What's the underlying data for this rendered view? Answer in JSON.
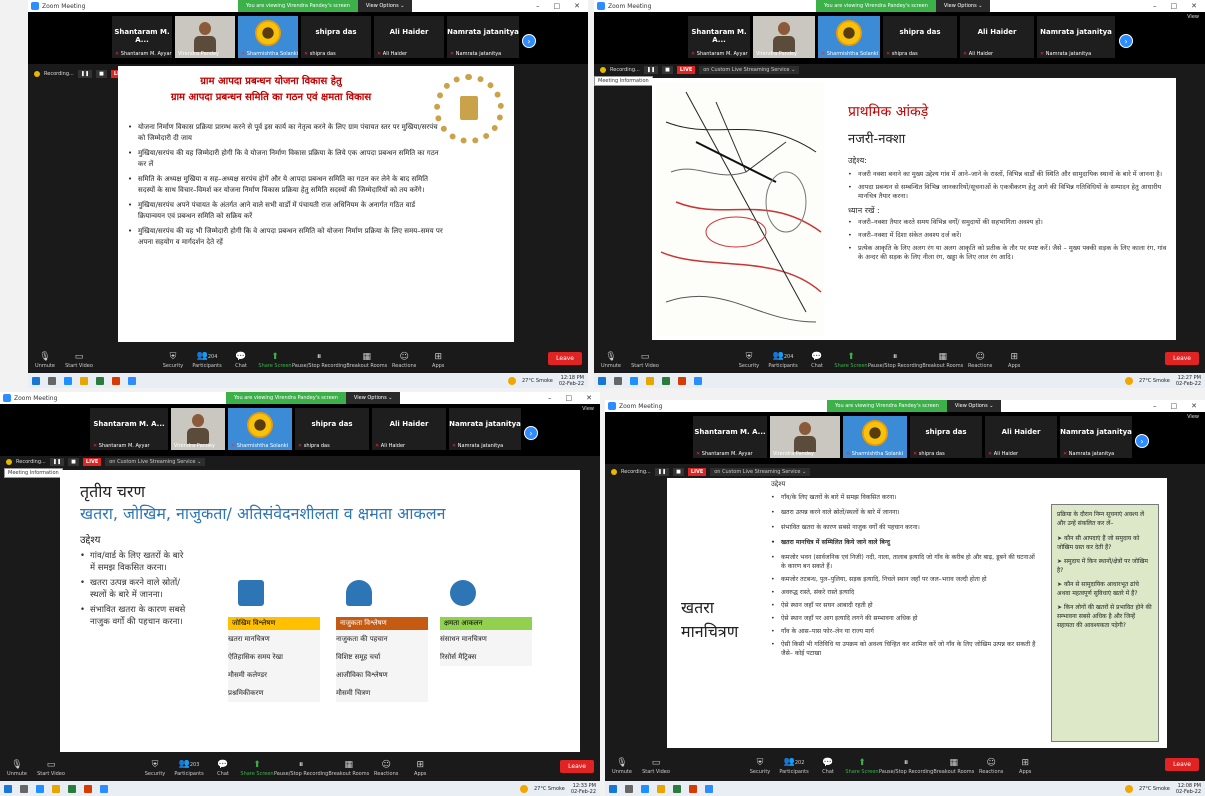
{
  "app": {
    "window_title": "Zoom Meeting",
    "banner": "You are viewing Virendra Pandey's screen",
    "view_options": "View Options ⌄",
    "view_label": "View",
    "meeting_info": "Meeting Information"
  },
  "participants": {
    "p1_name": "Shantaram M. A...",
    "p1_label": "Shantaram M. Ayyar",
    "p2_label": "Virendra Pandey",
    "p3_label": "Sharmishtha Solanki",
    "p4_name": "shipra das",
    "p4_label": "shipra das",
    "p5_name": "Ali Haider",
    "p5_label": "Ali Haider",
    "p6_name": "Namrata jatanitya",
    "p6_label": "Namrata jatanitya"
  },
  "recbar": {
    "recording": "Recording...",
    "live": "LIVE",
    "service": "on Custom Live Streaming Service ⌄"
  },
  "toolbar": {
    "unmute": "Unmute",
    "start_video": "Start Video",
    "security": "Security",
    "participants": "Participants",
    "chat": "Chat",
    "share": "Share Screen",
    "pause": "Pause/Stop Recording",
    "breakout": "Breakout Rooms",
    "reactions": "Reactions",
    "apps": "Apps",
    "leave": "Leave",
    "count_a": "204",
    "count_b": "204",
    "count_c": "203",
    "count_d": "202"
  },
  "taskbar": {
    "weather": "27°C Smoke",
    "time_a": "12:18 PM",
    "time_b": "12:27 PM",
    "time_c": "12:33 PM",
    "time_d": "12:08 PM",
    "date": "02-Feb-22"
  },
  "slide1": {
    "title1": "ग्राम आपदा प्रबन्धन योजना विकास हेतु",
    "title2": "ग्राम आपदा प्रबन्धन समिति का  गठन एवं क्षमता विकास",
    "bullets": [
      "योजना निर्माण विकास प्रक्रिया प्रारम्भ करने से पूर्व इस कार्य का नेतृत्व करने के लिए ग्राम पंचायत स्तर पर मुखिया/सरपंच को जिम्मेदारी दी जाय",
      "मुखिया/सरपंच की यह  जिम्मेदारी होगी कि वे योजना निर्माण विकास प्रक्रिया के लिये एक आपदा प्रबन्धन समिति का गठन कर लें",
      "समिति के अध्यक्ष मुखिया व सह–अध्यक्ष सरपंच होगें और ये आपदा प्रबन्धन समिति का गठन कर लेने के बाद समिति सदस्यों के साथ विचार–विमर्श कर योजना निर्माण विकास प्रक्रिया हेतु समिति सदस्यों की जिम्मेदारियों को तय करेंगे।",
      "मुखिया/सरपंच अपने पंचायत के अंतर्गत आने वाले सभी वार्डों में पंचायती राज अधिनियम के अनार्गत गठित वार्ड क्रियान्वयन एवं प्रबन्धन समिति को सक्रिय करें",
      "मुखिया/सरपंच की यह भी जिम्मेदारी होगी कि वे आपदा प्रबन्धन समिति को योजना निर्माण प्रक्रिया के लिए समय–समय पर अपना सहयोग व मार्गदर्शन देते रहें"
    ]
  },
  "slide2": {
    "title": "प्राथमिक आंकड़े",
    "subtitle": "नजरी-नक्शा",
    "purpose": "उद्देश्य:",
    "bullets": [
      "नजरी नक्शा बनाने का मुख्य उद्देश्य गांव में आने–जाने के रास्तों, विभिन्न वार्डों की स्थिति और सामुदायिक स्थानों के बारे में जानना है।",
      "आपदा प्रबन्धन से सम्बन्धित विभिन्न जानकारियों/सूचनाओं के एकत्रीकरण हेतु आगे की विभिन्न गतिविधियों के सम्पादन हेतु आधारीय मानचित्र तैयार करना।"
    ],
    "note": "ध्यान रखें :",
    "notes": [
      "नजरी–नक्शा तैयार करते समय विभिन्न वर्गों/ समुदायों की सहभागिता अवश्य हो।",
      "नजरी–नक्शा में दिशा संकेत अवश्य दर्ज करें।",
      "प्रत्येक आकृति के लिए अलग रंग या अलग आकृति को प्रतीक के तौर पर स्पष्ट करें। जैसे – मुख्य पक्की सड़क के लिए काला रंग, गांव के अन्दर की सड़क के लिए नीला रंग, खड्डा के लिए लाल रंग आदि।"
    ],
    "map_label": "नजरी-नक्शा"
  },
  "slide3": {
    "title1": "तृतीय चरण",
    "title2": "खतरा, जोखिम, नाजुकता/ अतिसंवेदनशीलता व क्षमता आकलन",
    "purpose": "उद्देश्य",
    "bullets": [
      "गांव/वार्ड के लिए खतरों के बारे में समझ विकसित करना।",
      "खतरा उत्पन्न करने वाले स्रोतों/स्थलों के बारे में जानना।",
      "संभावित खतरा के कारण सबसे नाजुक वर्गों की पहचान करना।"
    ],
    "col1": {
      "head": "जोखिम विश्लेषण",
      "items": [
        "खतरा मानचित्रण",
        "ऐतिहासिक समय रेखा",
        "मौसमी कलेण्डर",
        "प्रश्नमिकीकरण"
      ]
    },
    "col2": {
      "head": "नाजुकता विश्लेषण",
      "items": [
        "नाजुकता की पहचान",
        "विशिष्ट समूह चर्चा",
        "आजीविका विश्लेषण",
        "मौसमी चित्रण"
      ]
    },
    "col3": {
      "head": "क्षमता आकलन",
      "items": [
        "संसाधन मानचित्रण",
        "रिसोर्स मैट्रिक्स"
      ]
    }
  },
  "slide4": {
    "purpose": "उद्देश्य",
    "side_title": "खतरा मानचित्रण",
    "bullets": [
      "गाँव/के लिए खतरों के बारे में समझ विकसित करना।",
      "खतरा उत्पन्न करने वाले स्रोतों/स्थलों के बारे में जानना।",
      "संभावित खतरा के कारण सबसे नाजुक वर्गों की पहचान करना।"
    ],
    "heading": "खतरा मानचित्र में सम्मिलित किये जाने वाले बिन्दु",
    "points": [
      "कमजोर भवन (सार्वजनिक एवं निजी) नदी, नाला, तालाब इत्यादि जो गाँव के करीब हो और बाढ़, डूबने की घटनाओं के कारण बन सकते हैं।",
      "कमजोर तटबन्ध, पुल–पुलिया, सड़क इत्यादि, निचले स्थान जहाँ पर जल–भराव जल्दी होता हो",
      "अवरुद्ध रास्ते, संकरे रास्ते इत्यादि",
      "ऐसे स्थान जहाँ पर सघन आबादी रहती हो",
      "ऐसे स्थान जहाँ पर आग इत्यादि लगने की सम्भावना अधिक हो",
      "गाँव के आस–पास फोर–लेन या राज्य मार्ग",
      "ऐसी किसी भी गतिविधि या उपक्रम को अवश्य चिन्हित कर शामिल करें जो गाँव के लिए जोखिम उत्पन्न कर सकती है जैसे– कोई पटाखा"
    ],
    "box_title": "प्रक्रिया के दौरान निम्न सूचनाएं अवश्य लें और उन्हें संकलित कर लें–",
    "box_items": [
      "कौन सी आपदाएं हैं जो समुदाय को जोखिम ग्रस्त कर देती हैं?",
      "समुदाय में किन स्थानों/क्षेत्रों पर जोखिम है?",
      "कौन से सामुदायिक आधारभूत ढांचे अथवा महत्वपूर्ण सुविधाएं खतरे में हैं?",
      "किन लोगों की खतरों से प्रभावित होने की सम्भावना सबसे अधिक है और जिन्हें सहायता की आवश्यकता पड़ेगी?"
    ]
  }
}
